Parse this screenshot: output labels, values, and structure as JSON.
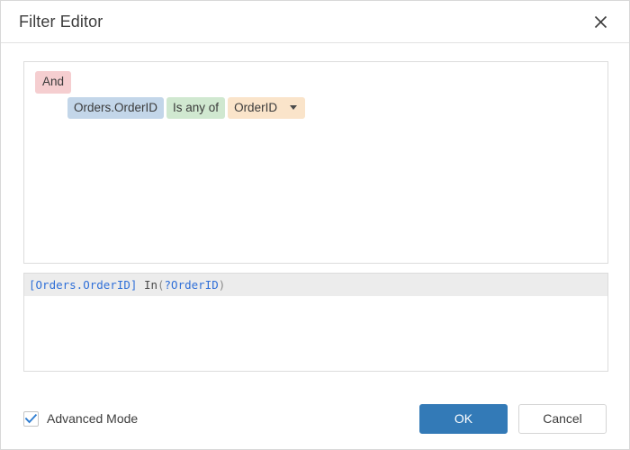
{
  "dialog": {
    "title": "Filter Editor",
    "close_icon": "close-icon"
  },
  "condition_panel": {
    "group": {
      "label": "And",
      "color": "#f5ced0"
    },
    "conditions": [
      {
        "field": "Orders.OrderID",
        "field_color": "#c3d6e9",
        "operator": "Is any of",
        "operator_color": "#d0e8d0",
        "value": "OrderID",
        "value_color": "#fae4ca",
        "value_caret_icon": "chevron-down-icon"
      }
    ]
  },
  "expression": {
    "lines": [
      {
        "active": true,
        "tokens": [
          {
            "text": "[Orders.OrderID]",
            "type": "field"
          },
          {
            "text": " In",
            "type": "plain"
          },
          {
            "text": "(",
            "type": "paren"
          },
          {
            "text": "?OrderID",
            "type": "param"
          },
          {
            "text": ")",
            "type": "paren"
          }
        ]
      }
    ]
  },
  "footer": {
    "advanced_mode_label": "Advanced Mode",
    "advanced_mode_checked": true,
    "check_icon": "check-icon",
    "ok_label": "OK",
    "cancel_label": "Cancel",
    "ok_color": "#337ab7"
  }
}
